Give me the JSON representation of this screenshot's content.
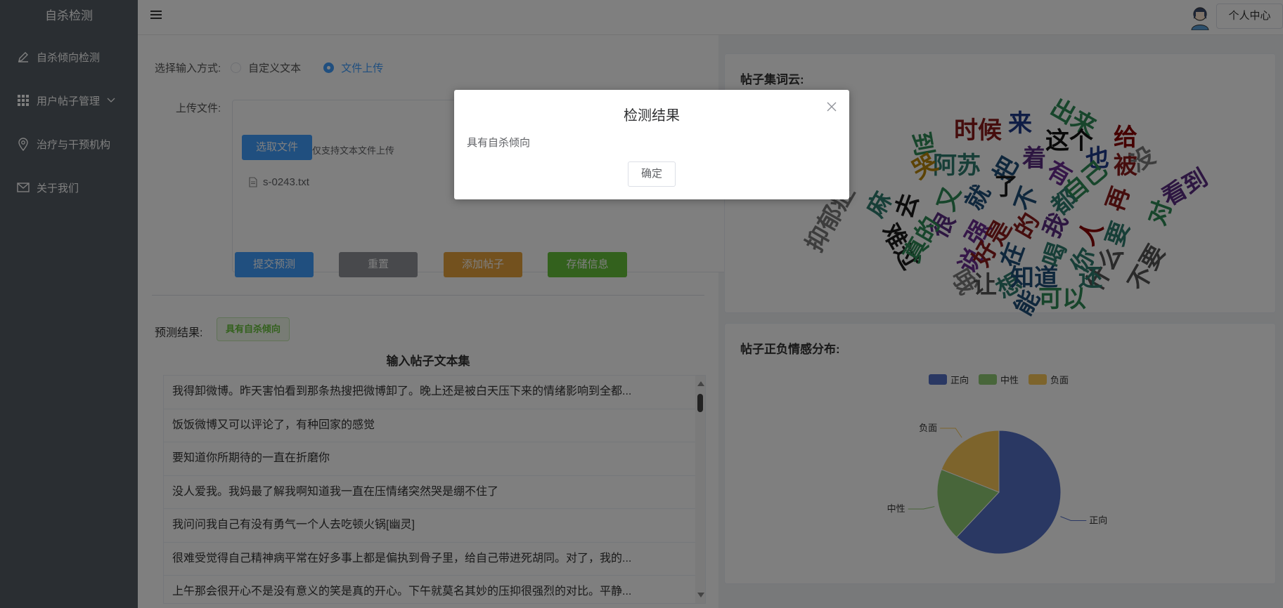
{
  "app": {
    "title": "自杀检测"
  },
  "sidebar": {
    "items": [
      {
        "label": "自杀倾向检测",
        "icon": "edit-icon"
      },
      {
        "label": "用户帖子管理",
        "icon": "grid-icon"
      },
      {
        "label": "治疗与干预机构",
        "icon": "location-icon"
      },
      {
        "label": "关于我们",
        "icon": "mail-icon"
      }
    ]
  },
  "header": {
    "user_label": "个人中心"
  },
  "form": {
    "input_mode_label": "选择输入方式:",
    "mode_custom": "自定义文本",
    "mode_upload": "文件上传",
    "selected_mode": "文件上传",
    "upload_label": "上传文件:",
    "choose_file": "选取文件",
    "upload_tip": "仅支持文本文件上传",
    "file_name": "s-0243.txt"
  },
  "actions": {
    "submit": "提交预测",
    "reset": "重置",
    "add_post": "添加帖子",
    "save": "存储信息"
  },
  "result": {
    "label": "预测结果:",
    "value": "具有自杀倾向"
  },
  "posts": {
    "title": "输入帖子文本集",
    "rows": [
      "我得卸微博。昨天害怕看到那条热搜把微博卸了。晚上还是被白天压下来的情绪影响到全都...",
      "饭饭微博又可以评论了，有种回家的感觉",
      "要知道你所期待的一直在折磨你",
      "没人爱我。我妈最了解我啊知道我一直在压情绪突然哭是绷不住了",
      "我问问我自己有没有勇气一个人去吃顿火锅[幽灵]",
      "很难受觉得自己精神病平常在好多事上都是偏执到骨子里，给自己带进死胡同。对了，我的...",
      "上午那会很开心不是没有意义的笑是真的开心。下午就莫名其妙的压抑很强烈的对比。平静..."
    ]
  },
  "wordcloud": {
    "title": "帖子集词云:",
    "words": [
      {
        "text": "出来",
        "color": "#2e8b57"
      },
      {
        "text": "时候",
        "color": "#8b1a1a"
      },
      {
        "text": "来",
        "color": "#1e3a8a"
      },
      {
        "text": "这个",
        "color": "#111111"
      },
      {
        "text": "给",
        "color": "#8b0000"
      },
      {
        "text": "也",
        "color": "#1e3a8a"
      },
      {
        "text": "被",
        "color": "#8b1a1a"
      },
      {
        "text": "没",
        "color": "#7a7a7a"
      },
      {
        "text": "看到",
        "color": "#5b2c83"
      },
      {
        "text": "阿苏",
        "color": "#2e7d6f"
      },
      {
        "text": "把",
        "color": "#1f4e79"
      },
      {
        "text": "着",
        "color": "#5b2c83"
      },
      {
        "text": "有",
        "color": "#6b2c91"
      },
      {
        "text": "自己",
        "color": "#2e8b57"
      },
      {
        "text": "再",
        "color": "#8b1a1a"
      },
      {
        "text": "对",
        "color": "#2e8b57"
      },
      {
        "text": "到",
        "color": "#2e8b57"
      },
      {
        "text": "哭",
        "color": "#b8860b"
      },
      {
        "text": "去",
        "color": "#1a1a1a"
      },
      {
        "text": "又",
        "color": "#2e8b57"
      },
      {
        "text": "就",
        "color": "#1f4e79"
      },
      {
        "text": "了",
        "color": "#1a1a1a"
      },
      {
        "text": "不",
        "color": "#1f4e79"
      },
      {
        "text": "都",
        "color": "#2e7d6f"
      },
      {
        "text": "人",
        "color": "#8b0000"
      },
      {
        "text": "要",
        "color": "#2e7d6f"
      },
      {
        "text": "抑郁症",
        "color": "#7a7a7a"
      },
      {
        "text": "麻",
        "color": "#2e7d6f"
      },
      {
        "text": "很",
        "color": "#5b2c83"
      },
      {
        "text": "强",
        "color": "#6b2c91"
      },
      {
        "text": "是",
        "color": "#8b1a1a"
      },
      {
        "text": "的",
        "color": "#8b1a1a"
      },
      {
        "text": "我",
        "color": "#5b2c83"
      },
      {
        "text": "难过",
        "color": "#1a1a1a"
      },
      {
        "text": "真的",
        "color": "#2e8b57"
      },
      {
        "text": "说",
        "color": "#6b2c91"
      },
      {
        "text": "好",
        "color": "#8b1a1a"
      },
      {
        "text": "在",
        "color": "#1f4e79"
      },
      {
        "text": "喝",
        "color": "#2e7d6f"
      },
      {
        "text": "你",
        "color": "#2e7d6f"
      },
      {
        "text": "什么",
        "color": "#555555"
      },
      {
        "text": "不要",
        "color": "#555555"
      },
      {
        "text": "哦",
        "color": "#7a7a7a"
      },
      {
        "text": "让",
        "color": "#555555"
      },
      {
        "text": "想",
        "color": "#2e7d6f"
      },
      {
        "text": "知道",
        "color": "#1f4e79"
      },
      {
        "text": "还",
        "color": "#2e7d6f"
      },
      {
        "text": "能",
        "color": "#1f4e79"
      },
      {
        "text": "可以",
        "color": "#2e8b57"
      }
    ]
  },
  "sentiment": {
    "title": "帖子正负情感分布:",
    "legend": [
      {
        "name": "正向",
        "color": "#5470c6"
      },
      {
        "name": "中性",
        "color": "#91cc75"
      },
      {
        "name": "负面",
        "color": "#fac858"
      }
    ]
  },
  "chart_data": {
    "type": "pie",
    "categories": [
      "正向",
      "中性",
      "负面"
    ],
    "values": [
      62,
      19,
      19
    ],
    "colors": [
      "#5470c6",
      "#91cc75",
      "#fac858"
    ]
  },
  "dialog": {
    "title": "检测结果",
    "body": "具有自杀倾向",
    "ok": "确定",
    "close_icon": "close-icon"
  }
}
